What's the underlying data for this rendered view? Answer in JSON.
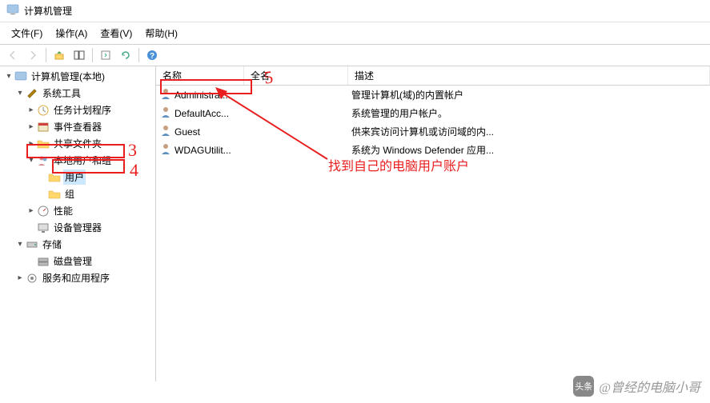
{
  "title": "计算机管理",
  "menu": {
    "file": "文件(F)",
    "action": "操作(A)",
    "view": "查看(V)",
    "help": "帮助(H)"
  },
  "tree": {
    "root": "计算机管理(本地)",
    "system_tools": "系统工具",
    "task_scheduler": "任务计划程序",
    "event_viewer": "事件查看器",
    "shared_folders": "共享文件夹",
    "local_users": "本地用户和组",
    "users": "用户",
    "groups": "组",
    "performance": "性能",
    "device_manager": "设备管理器",
    "storage": "存储",
    "disk_management": "磁盘管理",
    "services_apps": "服务和应用程序"
  },
  "columns": {
    "name": "名称",
    "fullname": "全名",
    "description": "描述"
  },
  "users": [
    {
      "name": "Administrat...",
      "fullname": "",
      "desc": "管理计算机(域)的内置帐户"
    },
    {
      "name": "DefaultAcc...",
      "fullname": "",
      "desc": "系统管理的用户帐户。"
    },
    {
      "name": "Guest",
      "fullname": "",
      "desc": "供来宾访问计算机或访问域的内..."
    },
    {
      "name": "WDAGUtilit...",
      "fullname": "",
      "desc": "系统为 Windows Defender 应用..."
    }
  ],
  "annotations": {
    "num3": "3",
    "num4": "4",
    "num5": "5",
    "hint": "找到自己的电脑用户账户"
  },
  "watermark": {
    "prefix": "头条",
    "author": "@曾经的电脑小哥"
  }
}
